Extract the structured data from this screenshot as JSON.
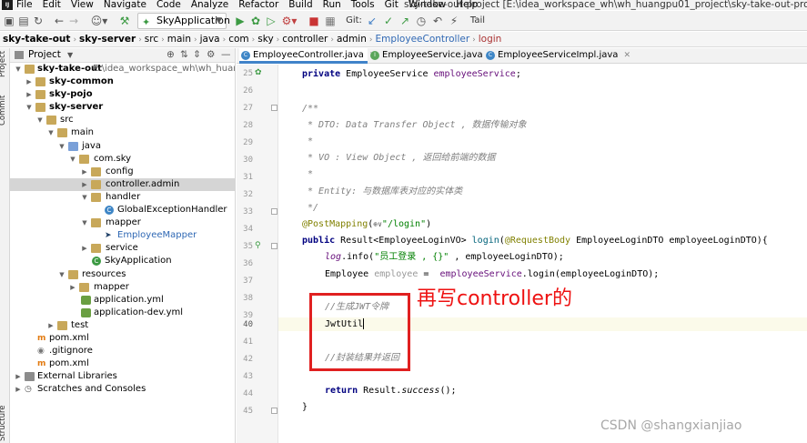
{
  "menubar": {
    "items": [
      "File",
      "Edit",
      "View",
      "Navigate",
      "Code",
      "Analyze",
      "Refactor",
      "Build",
      "Run",
      "Tools",
      "Git",
      "Window",
      "Help"
    ],
    "title": "sky-take-out-project [E:\\idea_workspace_wh\\wh_huangpu01_project\\sky-take-out-project] - EmployeeContro"
  },
  "toolbar": {
    "run_config": "SkyApplication",
    "git_label": "Git:",
    "tail_label": "Tail"
  },
  "breadcrumb": [
    "sky-take-out",
    "sky-server",
    "src",
    "main",
    "java",
    "com",
    "sky",
    "controller",
    "admin",
    "EmployeeController",
    "login"
  ],
  "left_strip": {
    "project": "Project",
    "commit": "Commit",
    "structure": "Structure"
  },
  "project_panel": {
    "header": "Project",
    "tree": [
      {
        "label": "sky-take-out",
        "extra": "E:\\idea_workspace_wh\\wh_huangpu01_",
        "bold": true
      },
      {
        "label": "sky-common",
        "bold": true
      },
      {
        "label": "sky-pojo",
        "bold": true
      },
      {
        "label": "sky-server",
        "bold": true
      },
      {
        "label": "src"
      },
      {
        "label": "main"
      },
      {
        "label": "java"
      },
      {
        "label": "com.sky"
      },
      {
        "label": "config"
      },
      {
        "label": "controller.admin"
      },
      {
        "label": "handler"
      },
      {
        "label": "GlobalExceptionHandler"
      },
      {
        "label": "mapper"
      },
      {
        "label": "EmployeeMapper"
      },
      {
        "label": "service"
      },
      {
        "label": "SkyApplication"
      },
      {
        "label": "resources"
      },
      {
        "label": "mapper"
      },
      {
        "label": "application.yml"
      },
      {
        "label": "application-dev.yml"
      },
      {
        "label": "test"
      },
      {
        "label": "pom.xml"
      },
      {
        "label": ".gitignore"
      },
      {
        "label": "pom.xml"
      },
      {
        "label": "External Libraries"
      },
      {
        "label": "Scratches and Consoles"
      }
    ]
  },
  "tabs": [
    "EmployeeController.java",
    "EmployeeService.java",
    "EmployeeServiceImpl.java"
  ],
  "code": {
    "line_numbers": [
      "25",
      "26",
      "27",
      "28",
      "29",
      "30",
      "31",
      "32",
      "33",
      "34",
      "35",
      "36",
      "37",
      "38",
      "39",
      "40",
      "41",
      "42",
      "43",
      "44",
      "45"
    ],
    "l25_kw": "private ",
    "l25_type": "EmployeeService ",
    "l25_field": "employeeService",
    "l25_end": ";",
    "l27": "/**",
    "l28": " * DTO: Data Transfer Object , 数据传输对象",
    "l29": " *",
    "l30": " * VO : View Object , 返回给前端的数据",
    "l31": " *",
    "l32": " * Entity: 与数据库表对应的实体类",
    "l33": " */",
    "l34_ann": "@PostMapping",
    "l34_open": "(",
    "l34_icon": "⊕∨",
    "l34_str": "\"/login\"",
    "l34_close": ")",
    "l35_kw": "public ",
    "l35_rest1": "Result<EmployeeLoginVO> ",
    "l35_method": "login",
    "l35_open": "(",
    "l35_ann": "@RequestBody ",
    "l35_rest2": "EmployeeLoginDTO employeeLoginDTO){",
    "l36_log": "log",
    "l36_a": ".info(",
    "l36_str": "\"员工登录 , {}\"",
    "l36_b": " , employeeLoginDTO);",
    "l37_a": "Employee ",
    "l37_var": "employee",
    "l37_b": " =  ",
    "l37_field": "employeeService",
    "l37_c": ".login(employeeLoginDTO);",
    "l39": "//生成JWT令牌",
    "l40": "JwtUtil",
    "l42": "//封装结果并返回",
    "l44_kw": "return ",
    "l44_a": "Result.",
    "l44_static": "success",
    "l44_b": "();",
    "l45": "}"
  },
  "annotation": {
    "text": "再写controller的"
  },
  "watermark": "CSDN @shangxianjiao"
}
